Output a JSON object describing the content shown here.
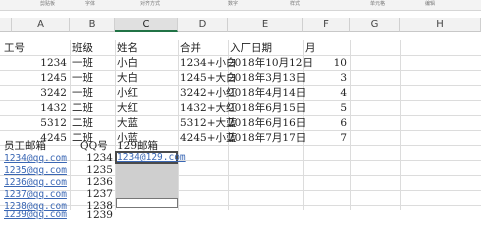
{
  "ribbon": {
    "groups": [
      "剪贴板",
      "字体",
      "对齐方式",
      "数字",
      "样式",
      "单元格",
      "编辑"
    ]
  },
  "sheet": {
    "columns": [
      "A",
      "B",
      "C",
      "D",
      "E",
      "F",
      "G",
      "H"
    ],
    "header_row": {
      "a": "工号",
      "b": "班级",
      "c": "姓名",
      "d": "合并",
      "e": "入厂日期",
      "f": "月"
    },
    "rows": [
      {
        "a": "1234",
        "b": "一班",
        "c": "小白",
        "d": "1234+小白",
        "e": "2018年10月12日",
        "f": "10"
      },
      {
        "a": "1245",
        "b": "一班",
        "c": "大白",
        "d": "1245+大白",
        "e": "2018年3月13日",
        "f": "3"
      },
      {
        "a": "3242",
        "b": "一班",
        "c": "小红",
        "d": "3242+小红",
        "e": "2018年4月14日",
        "f": "4"
      },
      {
        "a": "1432",
        "b": "二班",
        "c": "大红",
        "d": "1432+大红",
        "e": "2018年6月15日",
        "f": "5"
      },
      {
        "a": "5312",
        "b": "二班",
        "c": "大蓝",
        "d": "5312+大蓝",
        "e": "2018年6月16日",
        "f": "6"
      },
      {
        "a": "4245",
        "b": "二班",
        "c": "小蓝",
        "d": "4245+小蓝",
        "e": "2018年7月17日",
        "f": "7"
      }
    ],
    "email_header": {
      "a": "员工邮箱",
      "b": "QQ号",
      "c": "129邮箱"
    },
    "email_rows": [
      {
        "a": "1234@qq.com",
        "b": "1234",
        "c": "1234@129.com"
      },
      {
        "a": "1235@qq.com",
        "b": "1235",
        "c": ""
      },
      {
        "a": "1236@qq.com",
        "b": "1236",
        "c": ""
      },
      {
        "a": "1237@qq.com",
        "b": "1237",
        "c": ""
      },
      {
        "a": "1238@qq.com",
        "b": "1238",
        "c": ""
      },
      {
        "a": "1239@qq.com",
        "b": "1239",
        "c": ""
      }
    ]
  }
}
